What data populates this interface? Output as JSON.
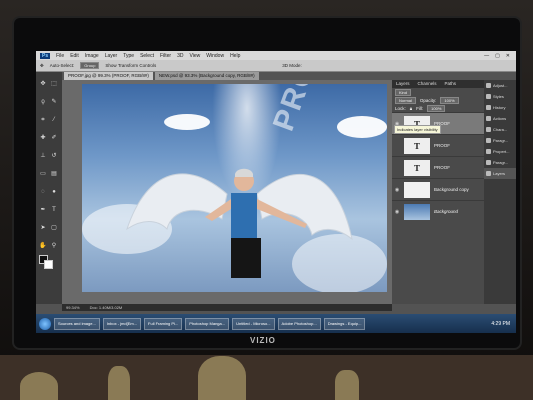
{
  "app": {
    "menu": [
      "File",
      "Edit",
      "Image",
      "Layer",
      "Type",
      "Select",
      "Filter",
      "3D",
      "View",
      "Window",
      "Help"
    ],
    "window_controls": [
      "—",
      "▢",
      "✕"
    ]
  },
  "options_bar": {
    "auto_select": "Auto-Select:",
    "group": "Group",
    "show_transform": "Show Transform Controls",
    "mode": "3D Mode:"
  },
  "doc_tabs": [
    "PROOF.jpg @ 99.3% (PROOF, RGB/8#)",
    "NEW.psd @ 93.3% (Background copy, RGB/8#)"
  ],
  "canvas": {
    "watermark": "PROOF"
  },
  "status_bar": {
    "zoom": "99.34%",
    "doc": "Doc: 1.40M/3.02M"
  },
  "layers_panel": {
    "tabs": [
      "Layers",
      "Channels",
      "Paths"
    ],
    "kind": "Kind",
    "blend_mode": "Normal",
    "opacity_label": "Opacity:",
    "opacity": "100%",
    "lock_label": "Lock:",
    "fill_label": "Fill:",
    "fill": "100%",
    "tooltip": "Indicates layer visibility",
    "layers": [
      {
        "name": "PROOF",
        "thumb": "T",
        "type": "text",
        "active": true
      },
      {
        "name": "PROOF",
        "thumb": "T",
        "type": "text",
        "active": false
      },
      {
        "name": "PROOF",
        "thumb": "T",
        "type": "text",
        "active": false
      },
      {
        "name": "Background copy",
        "thumb": "",
        "type": "white",
        "active": false
      },
      {
        "name": "Background",
        "thumb": "",
        "type": "photo",
        "active": false
      }
    ]
  },
  "side_dock": {
    "items": [
      "Adjust...",
      "Styles",
      "History",
      "Actions",
      "Chara...",
      "Paragr...",
      "Propert...",
      "Paragr...",
      "Layers"
    ]
  },
  "taskbar": {
    "items": [
      "Sources and image...",
      "Inbox - jmd[Em...",
      "Full Framing Pi...",
      "Photoshop Manga...",
      "Untitled - Microso...",
      "Adobe Photoshop...",
      "Drawings - Equip..."
    ],
    "time": "4:29 PM"
  },
  "monitor": {
    "brand": "VIZIO"
  },
  "colors": {
    "accent": "#0c3b78",
    "panel": "#4a4a4a",
    "taskbar": "#1d3b5e"
  }
}
